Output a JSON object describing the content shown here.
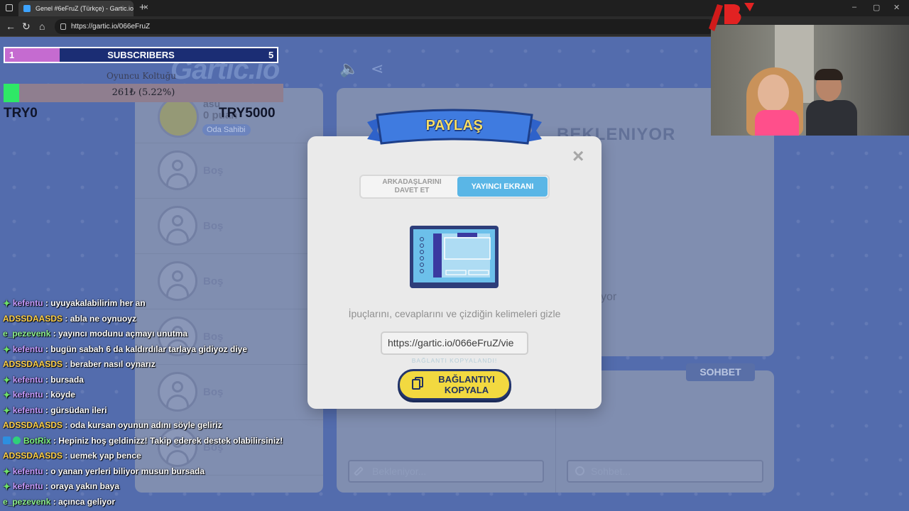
{
  "browser": {
    "tab_title": "Genel #6eFruZ (Türkçe) - Gartic.io",
    "url": "https://gartic.io/066eFruZ"
  },
  "stream": {
    "subscribers": {
      "current": "1",
      "goal": "5",
      "label": "SUBSCRIBERS",
      "fraction": 0.2
    },
    "donation_goal": {
      "title": "Oyuncu Koltuğu",
      "progress_text": "261₺ (5.22%)",
      "fraction": 0.0522,
      "min_label": "TRY0",
      "max_label": "TRY5000"
    }
  },
  "game": {
    "logo": "Gartic.io",
    "owner": {
      "name": "asu",
      "points": "0 puan",
      "badge": "Oda Sahibi"
    },
    "empty_slot_label": "Boş",
    "main_title": "BEKLENIYOR",
    "main_waiting": "yor",
    "answer_placeholder": "Bekleniyor...",
    "chat_placeholder": "Sohbet...",
    "chat_tab": "SOHBET"
  },
  "share_modal": {
    "title": "PAYLAŞ",
    "close": "×",
    "tabs": {
      "invite": "ARKADAŞLARINI DAVET ET",
      "streamer": "YAYINCI EKRANI"
    },
    "hint": "İpuçlarını, cevaplarını ve çizdiğin kelimeleri gizle",
    "link": "https://gartic.io/066eFruZ/vie",
    "copied": "BAĞLANTI KOPYALANDI!",
    "copy_button": "BAĞLANTIYI KOPYALA"
  },
  "chat": [
    {
      "user": "kefentu",
      "color": "#c79bff",
      "badge": "star",
      "message": "uyuyakalabilirim her an"
    },
    {
      "user": "ADSSDAASDS",
      "color": "#ffd14a",
      "badge": "",
      "message": "abla ne oynuoyz"
    },
    {
      "user": "e_pezevenk",
      "color": "#8df08d",
      "badge": "",
      "message": "yayıncı modunu açmayı unutma"
    },
    {
      "user": "kefentu",
      "color": "#c79bff",
      "badge": "star",
      "message": "bugün sabah 6 da kaldırdılar tarlaya gidiyoz diye"
    },
    {
      "user": "ADSSDAASDS",
      "color": "#ffd14a",
      "badge": "",
      "message": "beraber nasıl oynarız"
    },
    {
      "user": "kefentu",
      "color": "#c79bff",
      "badge": "star",
      "message": "bursada"
    },
    {
      "user": "kefentu",
      "color": "#c79bff",
      "badge": "star",
      "message": "köyde"
    },
    {
      "user": "kefentu",
      "color": "#c79bff",
      "badge": "star",
      "message": "gürsüdan ileri"
    },
    {
      "user": "ADSSDAASDS",
      "color": "#ffd14a",
      "badge": "",
      "message": "oda kursan oyunun adını söyle geliriz"
    },
    {
      "user": "BotRix",
      "color": "#7cf07c",
      "badge": "bot",
      "message": "Hepiniz hoş geldinizz! Takip ederek destek olabilirsiniz!"
    },
    {
      "user": "ADSSDAASDS",
      "color": "#ffd14a",
      "badge": "",
      "message": "uemek yap bence"
    },
    {
      "user": "kefentu",
      "color": "#c79bff",
      "badge": "star",
      "message": "o yanan yerleri biliyor musun bursada"
    },
    {
      "user": "kefentu",
      "color": "#c79bff",
      "badge": "star",
      "message": "oraya yakın baya"
    },
    {
      "user": "e_pezevenk",
      "color": "#8df08d",
      "badge": "",
      "message": "açınca geliyor"
    }
  ],
  "colors": {
    "game_bg": "#2c4fb0",
    "panel": "#6b7aa4",
    "accent_blue": "#5ab6e6",
    "button_yellow": "#f2d940",
    "sub_fill": "#c56bd0",
    "goal_fill": "#2ee866"
  }
}
